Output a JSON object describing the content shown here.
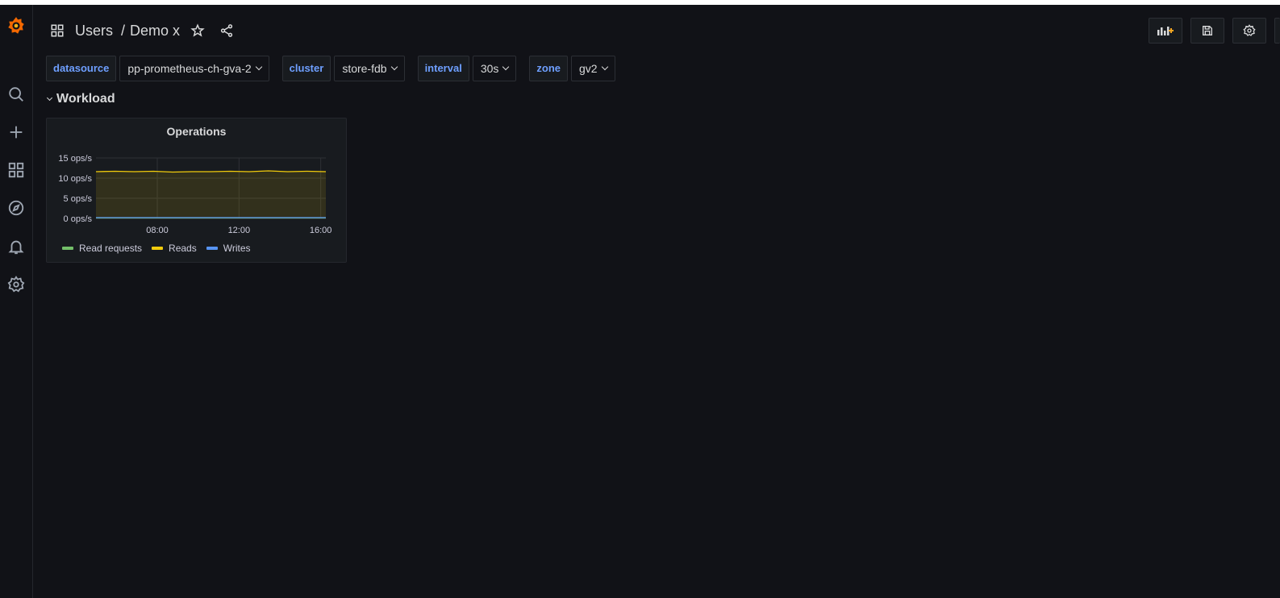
{
  "header": {
    "folder": "Users",
    "separator": "/",
    "dashboard": "Demo x"
  },
  "variables": [
    {
      "label": "datasource",
      "value": "pp-prometheus-ch-gva-2"
    },
    {
      "label": "cluster",
      "value": "store-fdb"
    },
    {
      "label": "interval",
      "value": "30s"
    },
    {
      "label": "zone",
      "value": "gv2"
    }
  ],
  "row": {
    "title": "Workload"
  },
  "panel": {
    "title": "Operations"
  },
  "chart_data": {
    "type": "area",
    "title": "Operations",
    "xlabel": "",
    "ylabel": "",
    "x": [
      "05:00",
      "06:00",
      "07:00",
      "08:00",
      "09:00",
      "10:00",
      "11:00",
      "12:00",
      "13:00",
      "14:00",
      "15:00",
      "16:00",
      "16:15"
    ],
    "xticks": [
      "08:00",
      "12:00",
      "16:00"
    ],
    "yticks": [
      "0 ops/s",
      "5 ops/s",
      "10 ops/s",
      "15 ops/s"
    ],
    "ylim": [
      0,
      15
    ],
    "grid": true,
    "legend": "bottom",
    "series": [
      {
        "name": "Read requests",
        "color": "#73bf69",
        "values": [
          0.1,
          0.1,
          0.1,
          0.1,
          0.1,
          0.1,
          0.1,
          0.1,
          0.1,
          0.1,
          0.1,
          0.1,
          0.1
        ]
      },
      {
        "name": "Reads",
        "color": "#f2cc0c",
        "values": [
          11.6,
          11.7,
          11.6,
          11.7,
          11.5,
          11.6,
          11.6,
          11.7,
          11.6,
          11.8,
          11.6,
          11.7,
          11.6
        ]
      },
      {
        "name": "Writes",
        "color": "#5794f2",
        "values": [
          0.2,
          0.2,
          0.2,
          0.2,
          0.2,
          0.2,
          0.2,
          0.2,
          0.2,
          0.2,
          0.2,
          0.2,
          0.2
        ]
      }
    ]
  },
  "colors": {
    "background": "#111217",
    "panel": "#181b1f",
    "accent": "#6e9fff",
    "logo": "#f46800"
  }
}
